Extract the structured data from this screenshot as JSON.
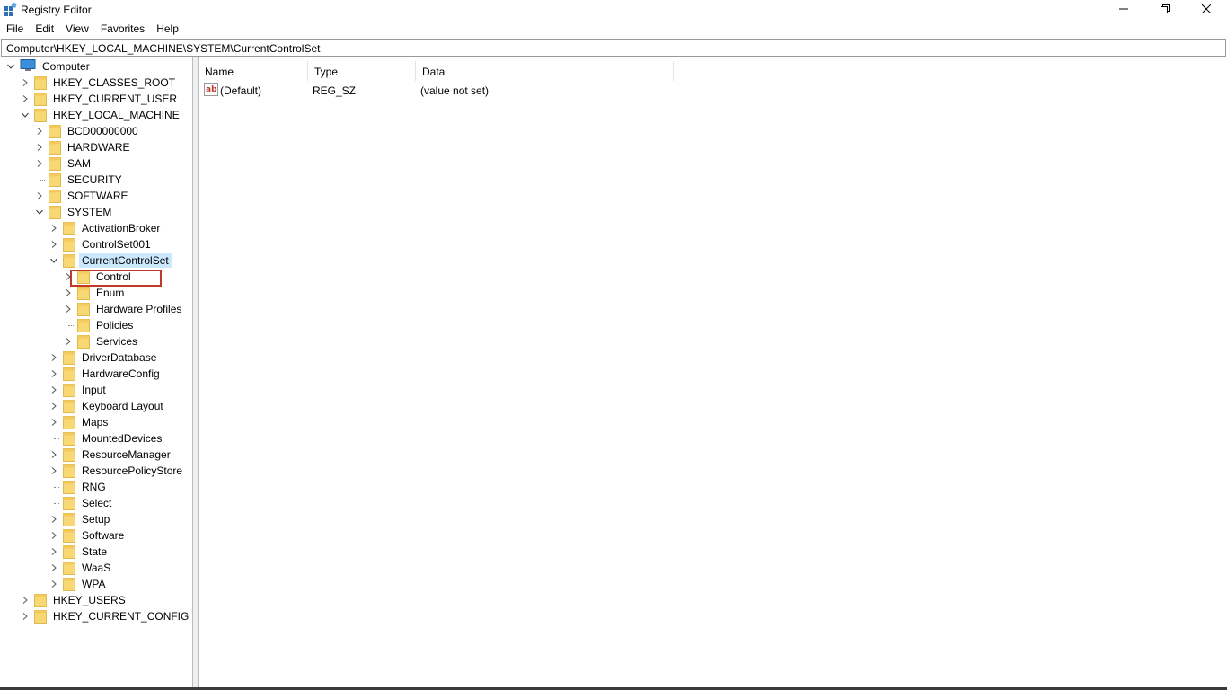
{
  "window": {
    "title": "Registry Editor",
    "minimize_glyph": "—",
    "restore_glyph": "❐",
    "close_glyph": "✕"
  },
  "menu": [
    "File",
    "Edit",
    "View",
    "Favorites",
    "Help"
  ],
  "address": "Computer\\HKEY_LOCAL_MACHINE\\SYSTEM\\CurrentControlSet",
  "tree": {
    "root": "Computer",
    "items": [
      {
        "label": "HKEY_CLASSES_ROOT",
        "state": "collapsed"
      },
      {
        "label": "HKEY_CURRENT_USER",
        "state": "collapsed"
      },
      {
        "label": "HKEY_LOCAL_MACHINE",
        "state": "expanded"
      },
      {
        "label": "BCD00000000",
        "state": "collapsed"
      },
      {
        "label": "HARDWARE",
        "state": "collapsed"
      },
      {
        "label": "SAM",
        "state": "collapsed"
      },
      {
        "label": "SECURITY",
        "state": "leaf"
      },
      {
        "label": "SOFTWARE",
        "state": "collapsed"
      },
      {
        "label": "SYSTEM",
        "state": "expanded"
      },
      {
        "label": "ActivationBroker",
        "state": "collapsed"
      },
      {
        "label": "ControlSet001",
        "state": "collapsed"
      },
      {
        "label": "CurrentControlSet",
        "state": "expanded",
        "selected": true
      },
      {
        "label": "Control",
        "state": "collapsed",
        "highlighted": true
      },
      {
        "label": "Enum",
        "state": "collapsed"
      },
      {
        "label": "Hardware Profiles",
        "state": "collapsed"
      },
      {
        "label": "Policies",
        "state": "leaf"
      },
      {
        "label": "Services",
        "state": "collapsed"
      },
      {
        "label": "DriverDatabase",
        "state": "collapsed"
      },
      {
        "label": "HardwareConfig",
        "state": "collapsed"
      },
      {
        "label": "Input",
        "state": "collapsed"
      },
      {
        "label": "Keyboard Layout",
        "state": "collapsed"
      },
      {
        "label": "Maps",
        "state": "collapsed"
      },
      {
        "label": "MountedDevices",
        "state": "leaf"
      },
      {
        "label": "ResourceManager",
        "state": "collapsed"
      },
      {
        "label": "ResourcePolicyStore",
        "state": "collapsed"
      },
      {
        "label": "RNG",
        "state": "leaf"
      },
      {
        "label": "Select",
        "state": "leaf"
      },
      {
        "label": "Setup",
        "state": "collapsed"
      },
      {
        "label": "Software",
        "state": "collapsed"
      },
      {
        "label": "State",
        "state": "collapsed"
      },
      {
        "label": "WaaS",
        "state": "collapsed"
      },
      {
        "label": "WPA",
        "state": "collapsed"
      },
      {
        "label": "HKEY_USERS",
        "state": "collapsed"
      },
      {
        "label": "HKEY_CURRENT_CONFIG",
        "state": "collapsed"
      }
    ]
  },
  "list": {
    "columns": {
      "name": "Name",
      "type": "Type",
      "data": "Data"
    },
    "rows": [
      {
        "name": "(Default)",
        "type": "REG_SZ",
        "data": "(value not set)",
        "icon": "string-value-icon"
      }
    ]
  },
  "colors": {
    "selection": "#cce8ff",
    "folder": "#f8d775",
    "highlight_border": "#c0392b"
  }
}
